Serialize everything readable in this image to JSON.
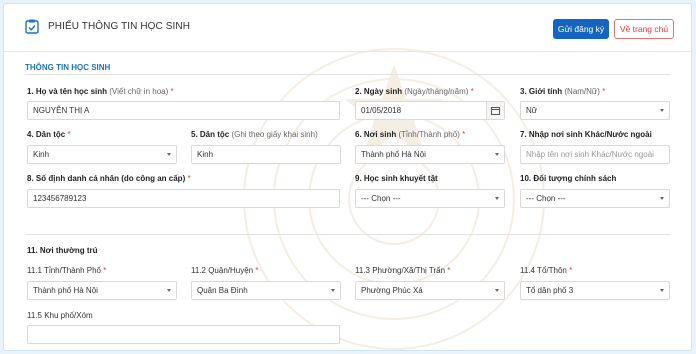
{
  "header": {
    "title": "PHIẾU THÔNG TIN HỌC SINH",
    "submit_label": "Gửi đăng ký",
    "home_label": "Về trang chủ"
  },
  "section": {
    "title": "THÔNG TIN HỌC SINH"
  },
  "fields": {
    "f1": {
      "label": "1. Họ và tên học sinh",
      "hint": "(Viết chữ in hoa)",
      "req": "*",
      "value": "NGUYỄN THỊ A"
    },
    "f2": {
      "label": "2. Ngày sinh",
      "hint": "(Ngày/tháng/năm)",
      "req": "*",
      "value": "01/05/2018"
    },
    "f3": {
      "label": "3. Giới tính",
      "hint": "(Nam/Nữ)",
      "req": "*",
      "value": "Nữ"
    },
    "f4": {
      "label": "4. Dân tộc",
      "req": "*",
      "value": "Kinh"
    },
    "f5": {
      "label": "5. Dân tộc",
      "hint": "(Ghi theo giấy khai sinh)",
      "value": "Kinh"
    },
    "f6": {
      "label": "6. Nơi sinh",
      "hint": "(Tỉnh/Thành phố)",
      "req": "*",
      "value": "Thành phố Hà Nội"
    },
    "f7": {
      "label": "7. Nhập nơi sinh Khác/Nước ngoài",
      "placeholder": "Nhập tên nơi sinh Khác/Nước ngoài"
    },
    "f8": {
      "label": "8. Số định danh cá nhân (do công an cấp)",
      "req": "*",
      "value": "123456789123"
    },
    "f9": {
      "label": "9. Học sinh khuyết tật",
      "value": "--- Chọn ---"
    },
    "f10": {
      "label": "10. Đối tượng chính sách",
      "value": "--- Chọn ---"
    }
  },
  "residence": {
    "heading": "11. Nơi thường trú",
    "r1": {
      "label": "11.1 Tỉnh/Thành Phố",
      "req": "*",
      "value": "Thành phố Hà Nội"
    },
    "r2": {
      "label": "11.2 Quận/Huyện",
      "req": "*",
      "value": "Quận Ba Đình"
    },
    "r3": {
      "label": "11.3 Phường/Xã/Thị Trấn",
      "req": "*",
      "value": "Phường Phúc Xá"
    },
    "r4": {
      "label": "11.4 Tổ/Thôn",
      "req": "*",
      "value": "Tổ dân phố 3"
    },
    "r5": {
      "label": "11.5 Khu phố/Xóm",
      "value": ""
    }
  },
  "colors": {
    "primary": "#1565c0",
    "danger": "#e53935",
    "section": "#1e73c6"
  }
}
